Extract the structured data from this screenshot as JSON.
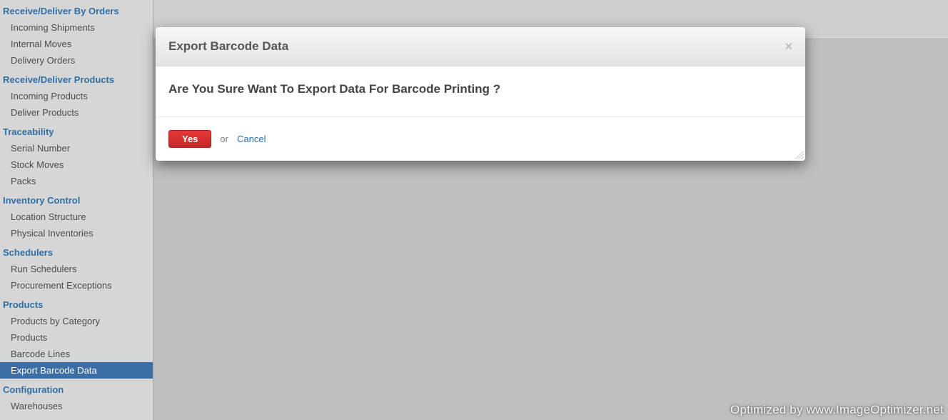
{
  "sidebar": {
    "sections": [
      {
        "title": "Receive/Deliver By Orders",
        "items": [
          {
            "label": "Incoming Shipments",
            "name": "incoming-shipments",
            "active": false
          },
          {
            "label": "Internal Moves",
            "name": "internal-moves",
            "active": false
          },
          {
            "label": "Delivery Orders",
            "name": "delivery-orders",
            "active": false
          }
        ]
      },
      {
        "title": "Receive/Deliver Products",
        "items": [
          {
            "label": "Incoming Products",
            "name": "incoming-products",
            "active": false
          },
          {
            "label": "Deliver Products",
            "name": "deliver-products",
            "active": false
          }
        ]
      },
      {
        "title": "Traceability",
        "items": [
          {
            "label": "Serial Number",
            "name": "serial-number",
            "active": false
          },
          {
            "label": "Stock Moves",
            "name": "stock-moves",
            "active": false
          },
          {
            "label": "Packs",
            "name": "packs",
            "active": false
          }
        ]
      },
      {
        "title": "Inventory Control",
        "items": [
          {
            "label": "Location Structure",
            "name": "location-structure",
            "active": false
          },
          {
            "label": "Physical Inventories",
            "name": "physical-inventories",
            "active": false
          }
        ]
      },
      {
        "title": "Schedulers",
        "items": [
          {
            "label": "Run Schedulers",
            "name": "run-schedulers",
            "active": false
          },
          {
            "label": "Procurement Exceptions",
            "name": "procurement-exceptions",
            "active": false
          }
        ]
      },
      {
        "title": "Products",
        "items": [
          {
            "label": "Products by Category",
            "name": "products-by-category",
            "active": false
          },
          {
            "label": "Products",
            "name": "products",
            "active": false
          },
          {
            "label": "Barcode Lines",
            "name": "barcode-lines",
            "active": false
          },
          {
            "label": "Export Barcode Data",
            "name": "export-barcode-data",
            "active": true
          }
        ]
      },
      {
        "title": "Configuration",
        "items": [
          {
            "label": "Warehouses",
            "name": "warehouses",
            "active": false
          }
        ]
      }
    ]
  },
  "modal": {
    "title": "Export Barcode Data",
    "body": "Are You Sure Want To Export Data For Barcode Printing ?",
    "yes": "Yes",
    "or": "or",
    "cancel": "Cancel"
  },
  "watermark": "Optimized by www.ImageOptimizer.net"
}
